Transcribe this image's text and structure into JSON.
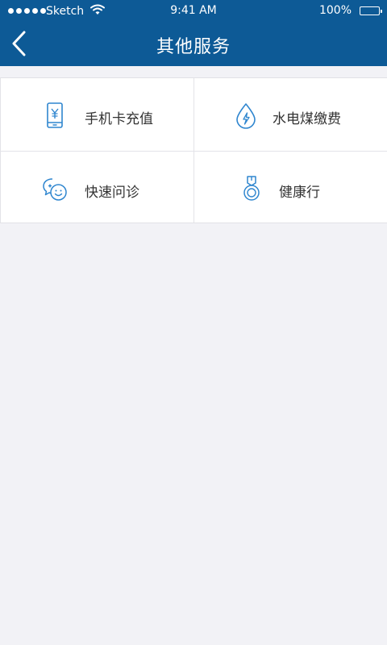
{
  "status_bar": {
    "carrier": "Sketch",
    "time": "9:41 AM",
    "battery": "100%"
  },
  "header": {
    "title": "其他服务"
  },
  "services": [
    {
      "label": "手机卡充值",
      "icon": "phone-yuan-icon"
    },
    {
      "label": "水电煤缴费",
      "icon": "water-drop-lightning-icon"
    },
    {
      "label": "快速问诊",
      "icon": "chat-smile-icon"
    },
    {
      "label": "健康行",
      "icon": "medal-icon"
    }
  ],
  "colors": {
    "header_bg": "#0d5a96",
    "page_bg": "#f2f2f6",
    "icon": "#2f86cf",
    "text": "#333333"
  }
}
